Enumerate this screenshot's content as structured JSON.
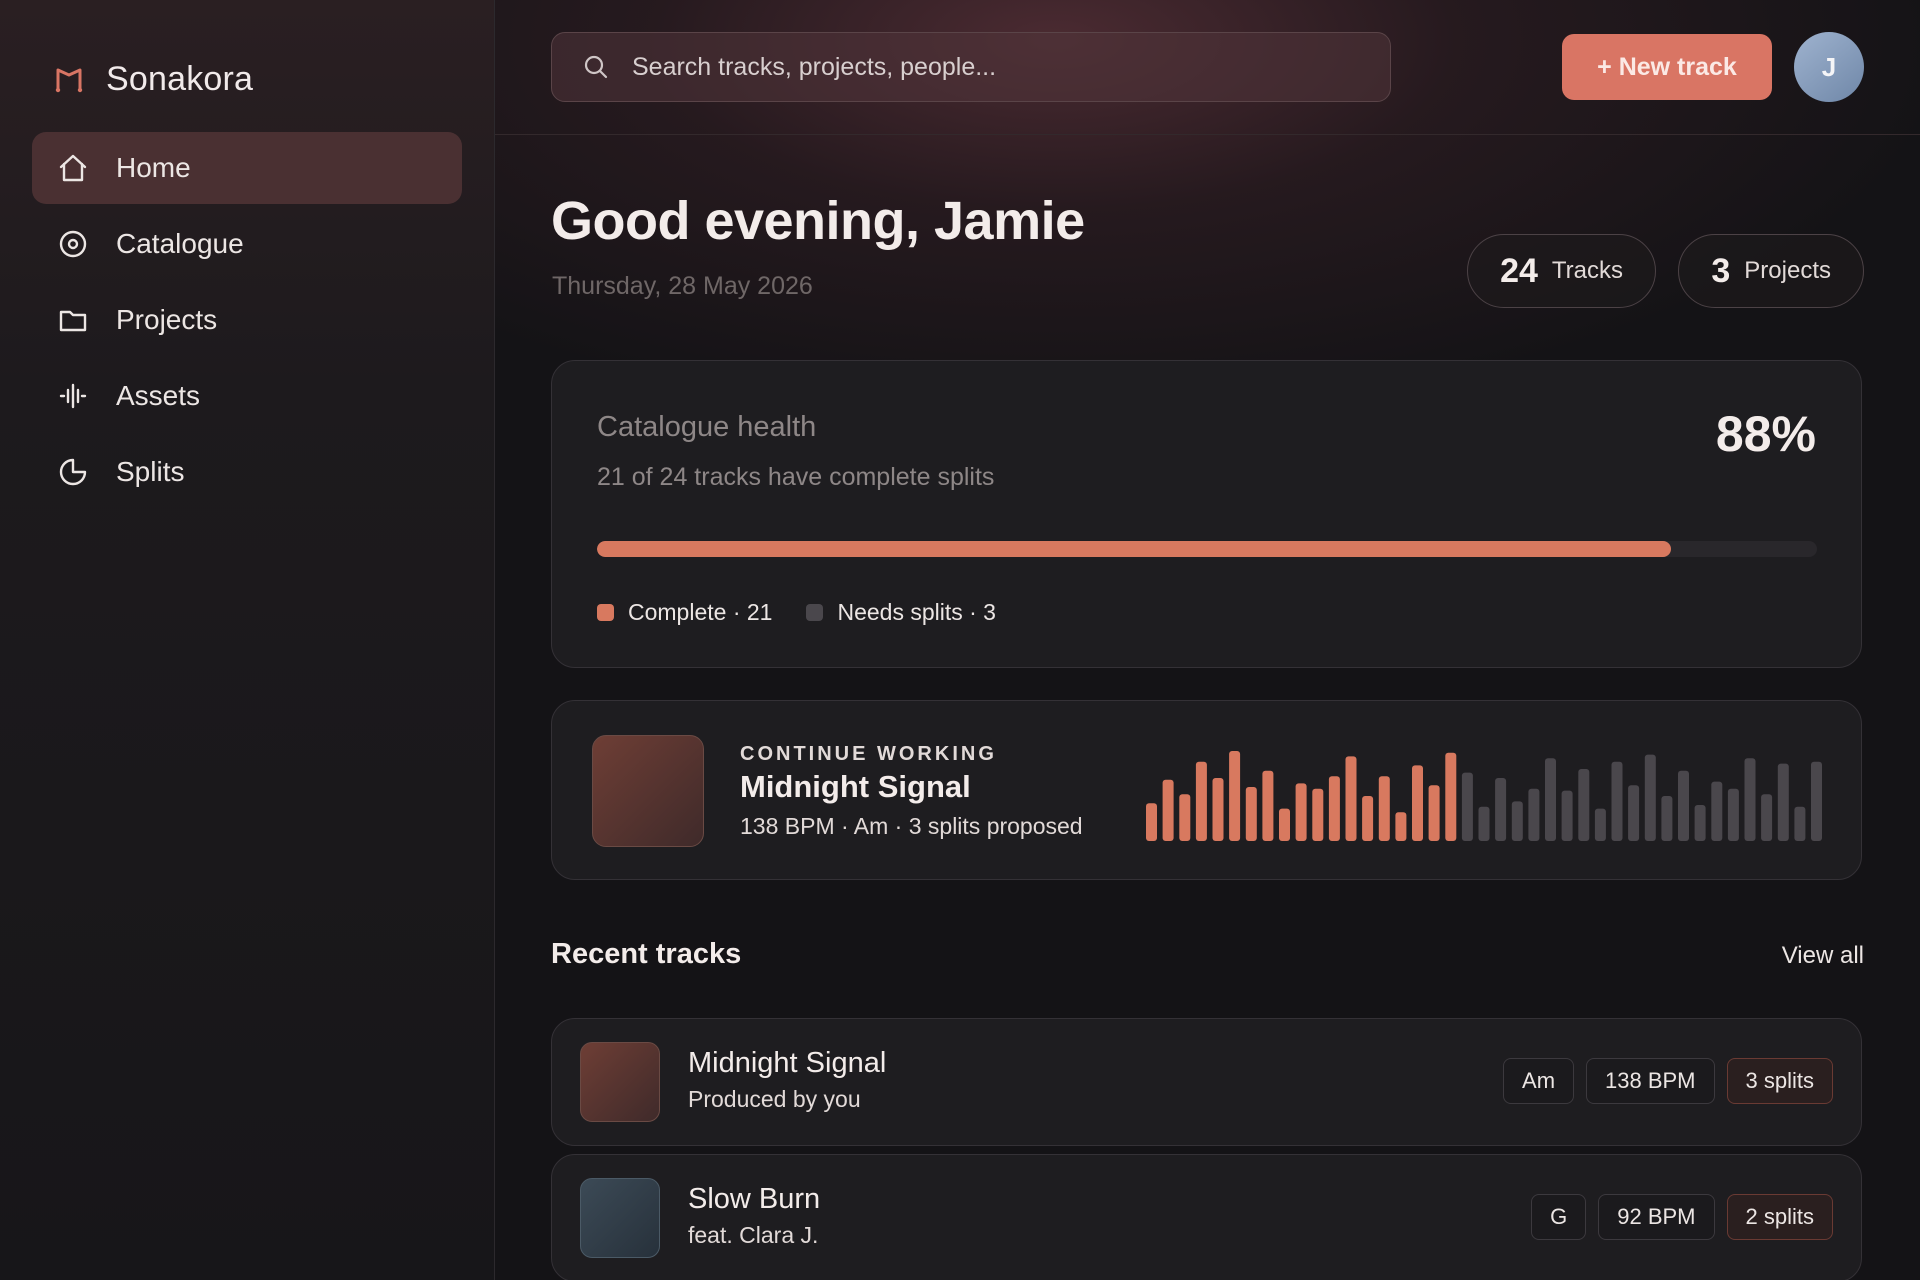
{
  "brand": {
    "name": "Sonakora",
    "icon": "music-note-icon",
    "accent": "#d97564"
  },
  "sidebar": {
    "items": [
      {
        "label": "Home",
        "icon": "home-icon",
        "active": true
      },
      {
        "label": "Catalogue",
        "icon": "disc-icon",
        "active": false
      },
      {
        "label": "Projects",
        "icon": "folder-icon",
        "active": false
      },
      {
        "label": "Assets",
        "icon": "waveform-icon",
        "active": false
      },
      {
        "label": "Splits",
        "icon": "pie-chart-icon",
        "active": false
      }
    ]
  },
  "header": {
    "search_placeholder": "Search tracks, projects, people...",
    "new_track_label": "+ New track",
    "avatar_initial": "J"
  },
  "main": {
    "greeting": "Good evening, Jamie",
    "date": "Thursday, 28 May 2026",
    "stats": [
      {
        "value": "24",
        "label": "Tracks"
      },
      {
        "value": "3",
        "label": "Projects"
      }
    ],
    "health": {
      "title": "Catalogue health",
      "subtitle": "21 of 24 tracks have complete splits",
      "percent_label": "88%",
      "progress": 0.88,
      "legend": [
        {
          "label": "Complete · 21",
          "color": "#d8795f"
        },
        {
          "label": "Needs splits · 3",
          "color": "#4a474c"
        }
      ]
    },
    "continue_working": {
      "kicker": "CONTINUE WORKING",
      "title": "Midnight Signal",
      "meta": "138 BPM · Am · 3 splits proposed",
      "played_color": "#d8795f",
      "unplayed_color": "#4a474c",
      "bars_played": [
        0.42,
        0.68,
        0.52,
        0.88,
        0.7,
        1.0,
        0.6,
        0.78,
        0.36,
        0.64,
        0.58,
        0.72,
        0.94,
        0.5,
        0.72,
        0.32,
        0.84,
        0.62,
        0.98
      ],
      "bars_unplayed": [
        0.76,
        0.38,
        0.7,
        0.44,
        0.58,
        0.92,
        0.56,
        0.8,
        0.36,
        0.88,
        0.62,
        0.96,
        0.5,
        0.78,
        0.4,
        0.66,
        0.58,
        0.92,
        0.52,
        0.86,
        0.38,
        0.88
      ]
    },
    "recent": {
      "title": "Recent tracks",
      "view_all": "View all",
      "tracks": [
        {
          "title": "Midnight Signal",
          "subtitle": "Produced by you",
          "key": "Am",
          "bpm": "138 BPM",
          "splits": "3 splits",
          "art": "warm"
        },
        {
          "title": "Slow Burn",
          "subtitle": "feat. Clara J.",
          "key": "G",
          "bpm": "92 BPM",
          "splits": "2 splits",
          "art": "cool"
        }
      ]
    }
  }
}
